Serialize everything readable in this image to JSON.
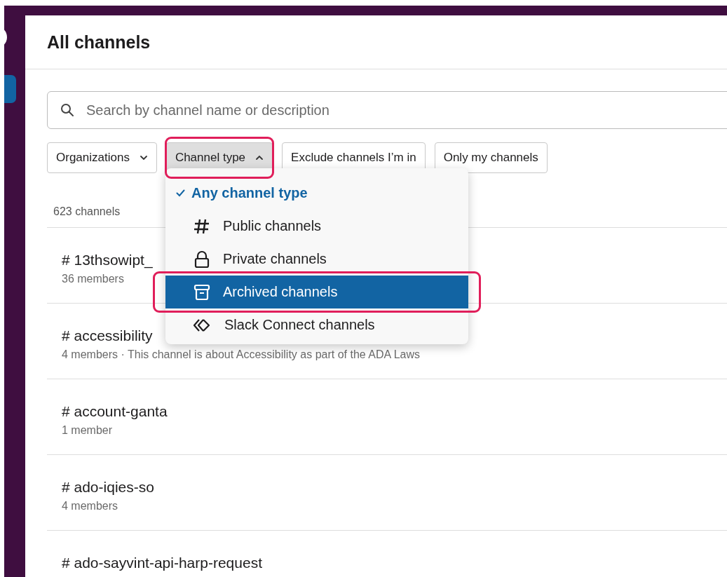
{
  "title": "All channels",
  "search": {
    "placeholder": "Search by channel name or description"
  },
  "filters": [
    {
      "label": "Organizations",
      "kind": "dropdown",
      "expanded": false,
      "annotated": false
    },
    {
      "label": "Channel type",
      "kind": "dropdown",
      "expanded": true,
      "annotated": true
    },
    {
      "label": "Exclude channels I’m in",
      "kind": "toggle"
    },
    {
      "label": "Only my channels",
      "kind": "toggle"
    }
  ],
  "count": "623 channels",
  "channels": [
    {
      "name": "# 13thsowipt_",
      "meta": "36 members"
    },
    {
      "name": "# accessibility",
      "meta": "4 members  ·  This channel is about Accessibility as part of the ADA Laws"
    },
    {
      "name": "# account-ganta",
      "meta": "1 member"
    },
    {
      "name": "# ado-iqies-so",
      "meta": "4 members"
    },
    {
      "name": "# ado-sayvint-api-harp-request"
    }
  ],
  "channel_type_menu": {
    "items": [
      {
        "label": "Any channel type",
        "kind": "check",
        "selected": true,
        "highlighted": false,
        "annotated": false
      },
      {
        "label": "Public channels",
        "kind": "hash",
        "selected": false,
        "highlighted": false,
        "annotated": false
      },
      {
        "label": "Private channels",
        "kind": "lock",
        "selected": false,
        "highlighted": false,
        "annotated": false
      },
      {
        "label": "Archived channels",
        "kind": "archive",
        "selected": false,
        "highlighted": true,
        "annotated": true
      },
      {
        "label": "Slack Connect channels",
        "kind": "connect",
        "selected": false,
        "highlighted": false,
        "annotated": false
      }
    ]
  }
}
